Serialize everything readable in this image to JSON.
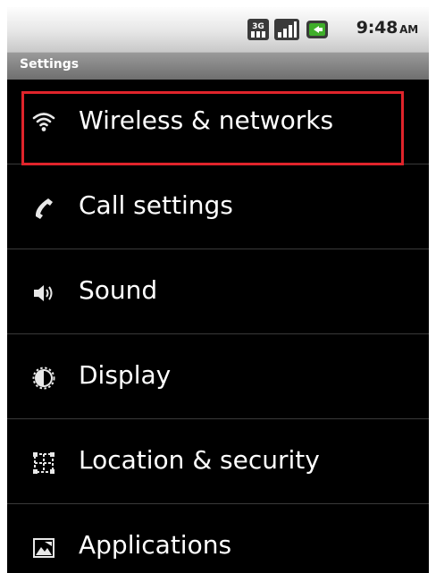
{
  "status_bar": {
    "time": "9:48",
    "ampm": "AM",
    "network_badge": "3G",
    "icons": [
      "3g-icon",
      "signal-icon",
      "battery-icon"
    ]
  },
  "title_bar": {
    "title": "Settings"
  },
  "settings": {
    "items": [
      {
        "label": "Wireless & networks",
        "icon": "wifi-icon"
      },
      {
        "label": "Call settings",
        "icon": "phone-icon"
      },
      {
        "label": "Sound",
        "icon": "speaker-icon"
      },
      {
        "label": "Display",
        "icon": "brightness-icon"
      },
      {
        "label": "Location & security",
        "icon": "location-grid-icon"
      },
      {
        "label": "Applications",
        "icon": "applications-icon"
      }
    ]
  },
  "highlight": {
    "color": "#e0242b",
    "target": "Wireless & networks"
  }
}
